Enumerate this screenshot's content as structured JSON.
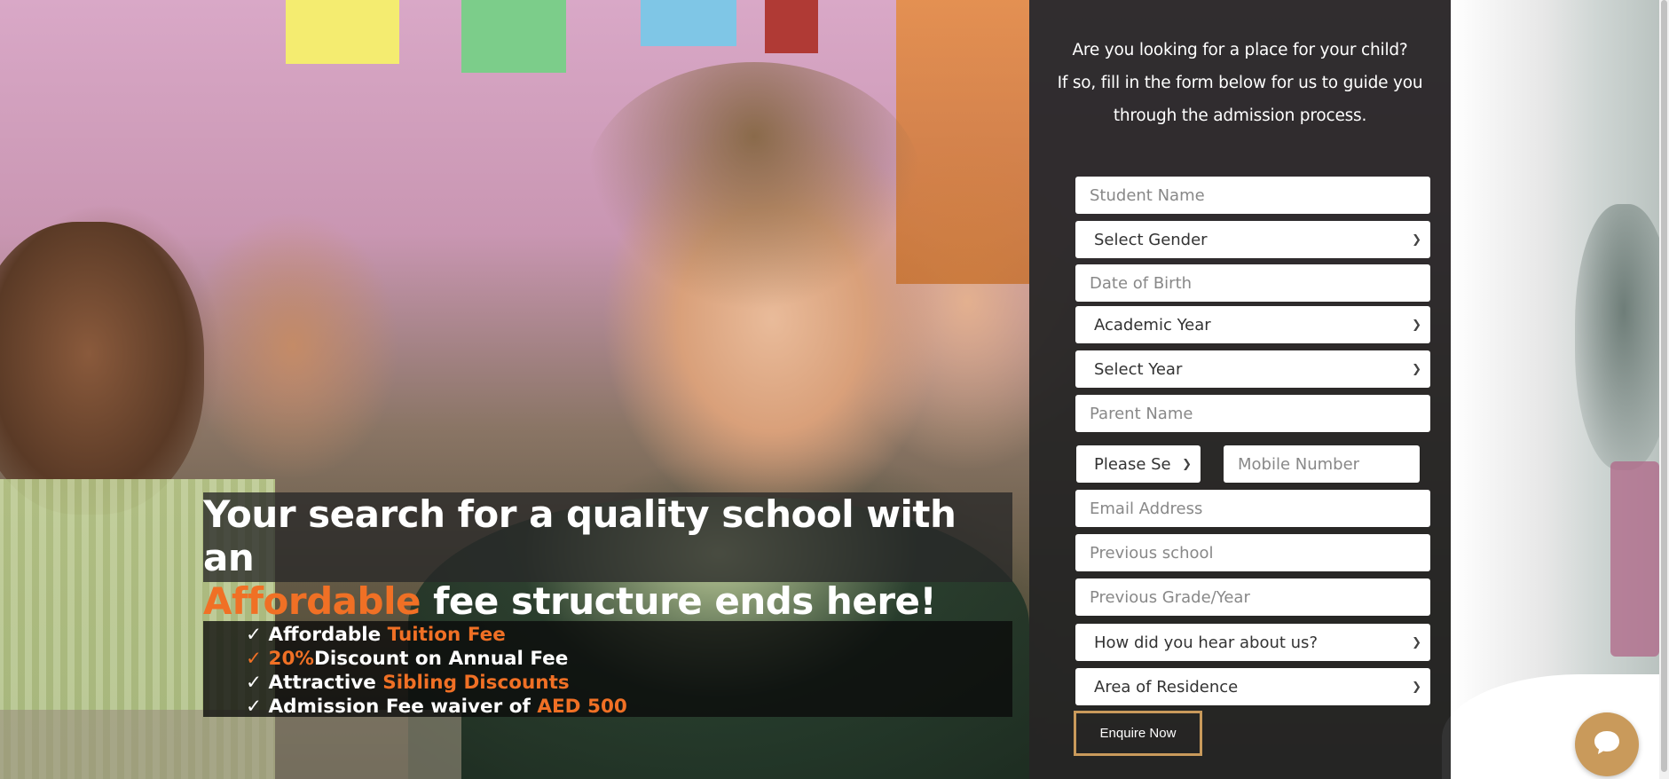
{
  "intro": {
    "line1": "Are you looking for a place for your child?",
    "line2": "If so, fill in the form below for us to guide you",
    "line3": "through the admission process."
  },
  "form": {
    "student_name_placeholder": "Student Name",
    "gender_select": "Select Gender",
    "dob_placeholder": "Date of Birth",
    "academic_year_select": "Academic Year",
    "year_select": "Select Year",
    "parent_name_placeholder": "Parent Name",
    "country_code_select": "Please Se",
    "mobile_placeholder": "Mobile Number",
    "email_placeholder": "Email Address",
    "previous_school_placeholder": "Previous school",
    "previous_grade_placeholder": "Previous Grade/Year",
    "hear_about_select": "How did you hear about us?",
    "residence_select": "Area of Residence",
    "submit_label": "Enquire Now"
  },
  "headline": {
    "line1": "Your search for a quality school with an",
    "highlight": "Affordable",
    "line2_rest": " fee structure ends here!"
  },
  "benefits": [
    {
      "check": "✓",
      "text": " Affordable ",
      "highlight": "Tuition Fee",
      "after": ""
    },
    {
      "check": "✓",
      "text": " ",
      "highlight": "20%",
      "after": "Discount on Annual Fee"
    },
    {
      "check": "✓",
      "text": " Attractive ",
      "highlight": "Sibling Discounts",
      "after": ""
    },
    {
      "check": "✓",
      "text": " Admission Fee waiver of ",
      "highlight": "AED 500",
      "after": ""
    }
  ],
  "colors": {
    "accent_orange": "#f07025",
    "button_border": "#c99a5b",
    "panel_bg": "#242424"
  },
  "icons": {
    "chevron": "chevron-down-icon",
    "chat": "chat-bubble-icon"
  }
}
